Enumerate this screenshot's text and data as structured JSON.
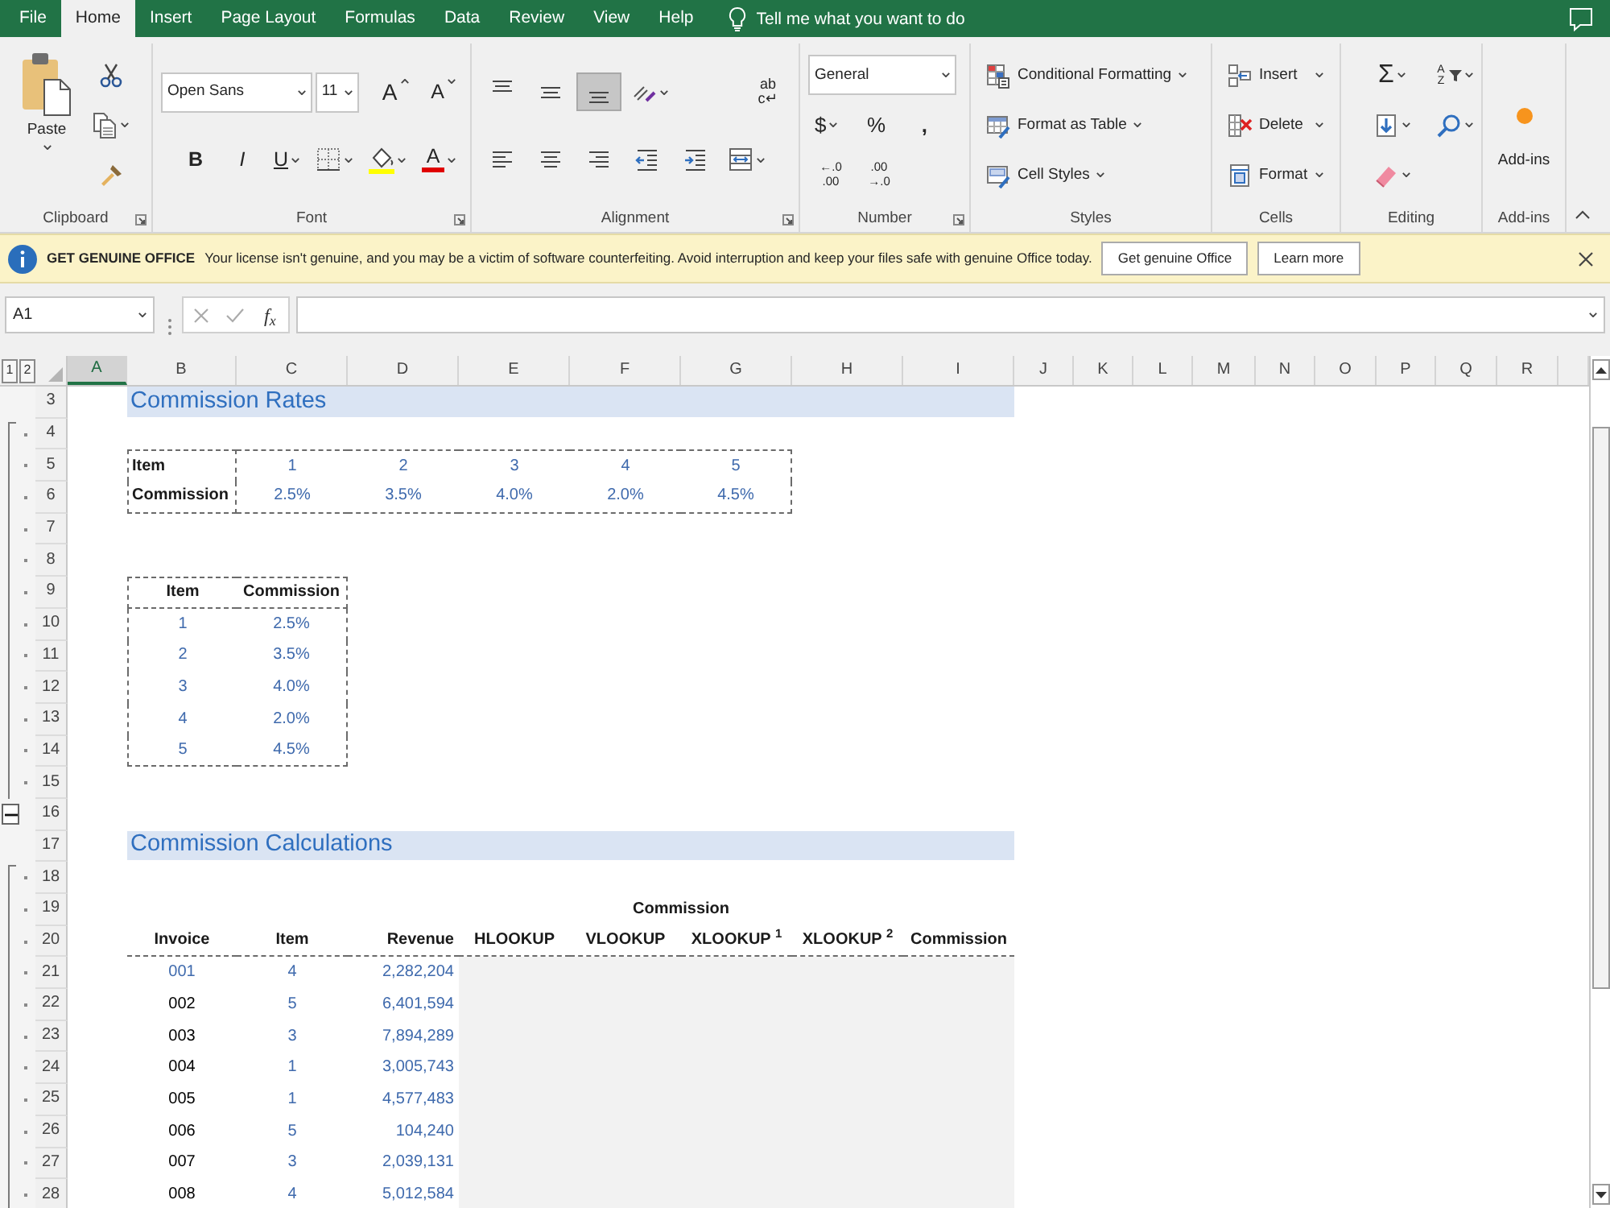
{
  "ribbon_tabs": [
    {
      "label": "File",
      "selected": false
    },
    {
      "label": "Home",
      "selected": true
    },
    {
      "label": "Insert",
      "selected": false
    },
    {
      "label": "Page Layout",
      "selected": false
    },
    {
      "label": "Formulas",
      "selected": false
    },
    {
      "label": "Data",
      "selected": false
    },
    {
      "label": "Review",
      "selected": false
    },
    {
      "label": "View",
      "selected": false
    },
    {
      "label": "Help",
      "selected": false
    }
  ],
  "tell_me": {
    "placeholder": "Tell me what you want to do"
  },
  "ribbon": {
    "clipboard": {
      "paste": "Paste",
      "label": "Clipboard"
    },
    "font": {
      "family": "Open Sans",
      "size": "11",
      "grow": "A",
      "shrink": "A",
      "bold": "B",
      "italic": "I",
      "underline": "U",
      "font_color": "A",
      "label": "Font"
    },
    "alignment": {
      "vertical": [
        {
          "selected": false
        },
        {
          "selected": false
        },
        {
          "selected": true
        }
      ],
      "wrap": [
        "ab",
        "c↵"
      ],
      "label": "Alignment"
    },
    "number": {
      "format": "General",
      "currency": "$",
      "percent": "%",
      "comma": ",",
      "increase_decimal": [
        "←.0",
        ".00"
      ],
      "decrease_decimal": [
        ".00",
        "→.0"
      ],
      "label": "Number"
    },
    "styles": {
      "items": [
        "Conditional Formatting",
        "Format as Table",
        "Cell Styles"
      ],
      "label": "Styles"
    },
    "cells": {
      "items": [
        "Insert",
        "Delete",
        "Format"
      ],
      "label": "Cells"
    },
    "editing": {
      "sum": "Σ",
      "sort": "AZ",
      "label": "Editing"
    },
    "addins": {
      "button": "Add-ins",
      "label": "Add-ins"
    }
  },
  "info_bar": {
    "title": "GET GENUINE OFFICE",
    "message": "Your license isn't genuine, and you may be a victim of software counterfeiting. Avoid interruption and keep your files safe with genuine Office today.",
    "buttons": [
      "Get genuine Office",
      "Learn more"
    ]
  },
  "formula_bar": {
    "name_box": "A1",
    "edit_buttons": [
      {
        "kind": "cancel",
        "disabled": true
      },
      {
        "kind": "enter",
        "disabled": true
      }
    ],
    "function": "f$_{x}$"
  },
  "sheet": {
    "outline_levels": [
      "1",
      "2"
    ],
    "columns": [
      {
        "label": "A",
        "selected": true
      },
      {
        "label": "B",
        "selected": false
      },
      {
        "label": "C",
        "selected": false
      },
      {
        "label": "D",
        "selected": false
      },
      {
        "label": "E",
        "selected": false
      },
      {
        "label": "F",
        "selected": false
      },
      {
        "label": "G",
        "selected": false
      },
      {
        "label": "H",
        "selected": false
      },
      {
        "label": "I",
        "selected": false
      },
      {
        "label": "J",
        "selected": false
      },
      {
        "label": "K",
        "selected": false
      },
      {
        "label": "L",
        "selected": false
      },
      {
        "label": "M",
        "selected": false
      },
      {
        "label": "N",
        "selected": false
      },
      {
        "label": "O",
        "selected": false
      },
      {
        "label": "P",
        "selected": false
      },
      {
        "label": "Q",
        "selected": false
      },
      {
        "label": "R",
        "selected": false
      }
    ],
    "rows": [
      {
        "label": "3",
        "kind": "plain"
      },
      {
        "label": "4",
        "kind": "grouped"
      },
      {
        "label": "5",
        "kind": "grouped"
      },
      {
        "label": "6",
        "kind": "grouped"
      },
      {
        "label": "7",
        "kind": "grouped"
      },
      {
        "label": "8",
        "kind": "grouped"
      },
      {
        "label": "9",
        "kind": "grouped"
      },
      {
        "label": "10",
        "kind": "grouped"
      },
      {
        "label": "11",
        "kind": "grouped"
      },
      {
        "label": "12",
        "kind": "grouped"
      },
      {
        "label": "13",
        "kind": "grouped"
      },
      {
        "label": "14",
        "kind": "grouped"
      },
      {
        "label": "15",
        "kind": "grouped"
      },
      {
        "label": "16",
        "kind": "collapse"
      },
      {
        "label": "17",
        "kind": "plain"
      },
      {
        "label": "18",
        "kind": "grouped"
      },
      {
        "label": "19",
        "kind": "grouped"
      },
      {
        "label": "20",
        "kind": "grouped"
      },
      {
        "label": "21",
        "kind": "grouped"
      },
      {
        "label": "22",
        "kind": "grouped"
      },
      {
        "label": "23",
        "kind": "grouped"
      },
      {
        "label": "24",
        "kind": "grouped"
      },
      {
        "label": "25",
        "kind": "grouped"
      },
      {
        "label": "26",
        "kind": "grouped"
      },
      {
        "label": "27",
        "kind": "grouped"
      },
      {
        "label": "28",
        "kind": "grouped"
      }
    ],
    "rates_title": "Commission Rates",
    "rates_across": {
      "row_labels": [
        "Item",
        "Commission"
      ],
      "items": [
        "1",
        "2",
        "3",
        "4",
        "5"
      ],
      "rates": [
        "2.5%",
        "3.5%",
        "4.0%",
        "2.0%",
        "4.5%"
      ]
    },
    "rates_down": {
      "headers": [
        "Item",
        "Commission"
      ],
      "rows": [
        {
          "item": "1",
          "rate": "2.5%"
        },
        {
          "item": "2",
          "rate": "3.5%"
        },
        {
          "item": "3",
          "rate": "4.0%"
        },
        {
          "item": "4",
          "rate": "2.0%"
        },
        {
          "item": "5",
          "rate": "4.5%"
        }
      ]
    },
    "calc_title": "Commission Calculations",
    "calc": {
      "group_heading": "Commission",
      "headers": [
        "Invoice",
        "Item",
        "Revenue",
        "HLOOKUP",
        "VLOOKUP",
        "XLOOKUP $^{1}$",
        "XLOOKUP $^{2}$",
        "Commission"
      ],
      "rows": [
        {
          "invoice": {
            "text": "001",
            "color": "#3f6aad"
          },
          "item": "4",
          "revenue": "2,282,204"
        },
        {
          "invoice": {
            "text": "002",
            "color": "#000000"
          },
          "item": "5",
          "revenue": "6,401,594"
        },
        {
          "invoice": {
            "text": "003",
            "color": "#000000"
          },
          "item": "3",
          "revenue": "7,894,289"
        },
        {
          "invoice": {
            "text": "004",
            "color": "#000000"
          },
          "item": "1",
          "revenue": "3,005,743"
        },
        {
          "invoice": {
            "text": "005",
            "color": "#000000"
          },
          "item": "1",
          "revenue": "4,577,483"
        },
        {
          "invoice": {
            "text": "006",
            "color": "#000000"
          },
          "item": "5",
          "revenue": "104,240"
        },
        {
          "invoice": {
            "text": "007",
            "color": "#000000"
          },
          "item": "3",
          "revenue": "2,039,131"
        },
        {
          "invoice": {
            "text": "008",
            "color": "#000000"
          },
          "item": "4",
          "revenue": "5,012,584"
        }
      ]
    }
  }
}
